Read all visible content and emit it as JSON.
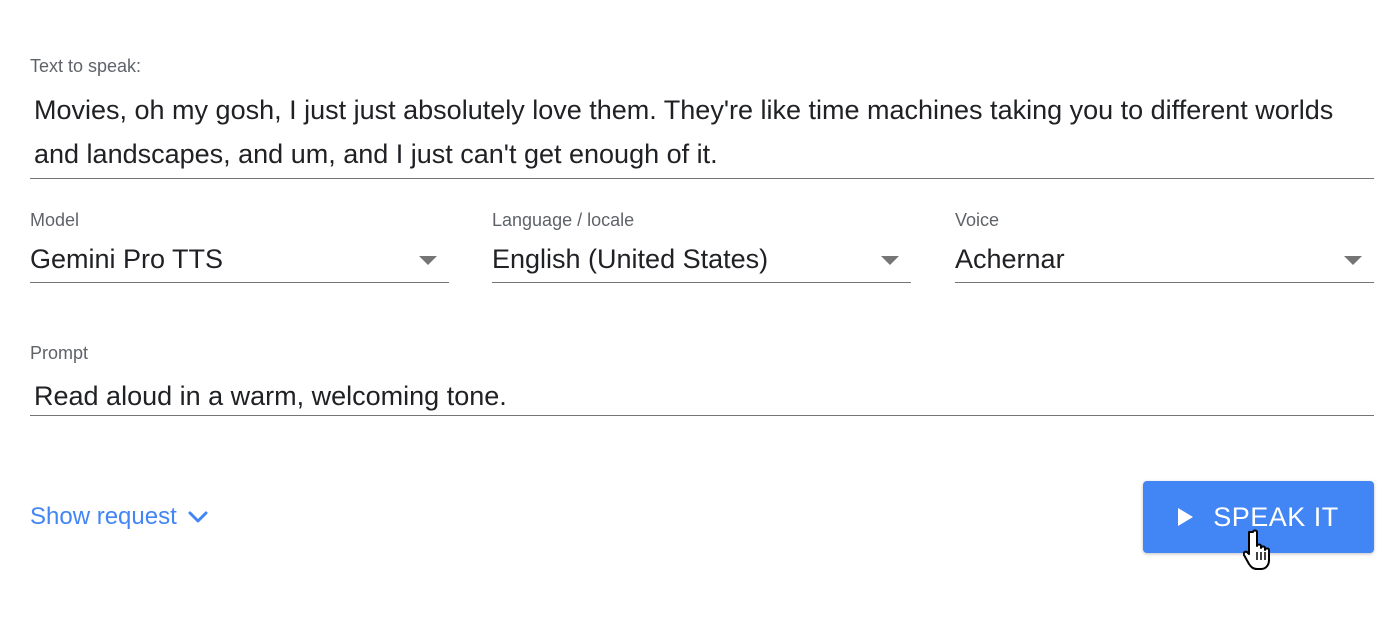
{
  "text_field": {
    "label": "Text to speak:",
    "value": "Movies, oh my gosh, I just just absolutely love them. They're like time machines taking you to different worlds and landscapes, and um, and I just can't get enough of it."
  },
  "model": {
    "label": "Model",
    "value": "Gemini Pro TTS",
    "icon": "chevron-down-icon"
  },
  "language": {
    "label": "Language / locale",
    "value": "English (United States)",
    "icon": "chevron-down-icon"
  },
  "voice": {
    "label": "Voice",
    "value": "Achernar",
    "icon": "chevron-down-icon"
  },
  "prompt": {
    "label": "Prompt",
    "value": "Read aloud in a warm, welcoming tone."
  },
  "show_request": {
    "label": "Show request",
    "icon": "chevron-down-icon"
  },
  "speak_button": {
    "label": "SPEAK IT",
    "icon": "play-icon"
  },
  "colors": {
    "accent": "#4285f4",
    "label_text": "#5f6368",
    "body_text": "#202124",
    "underline": "#757575"
  }
}
